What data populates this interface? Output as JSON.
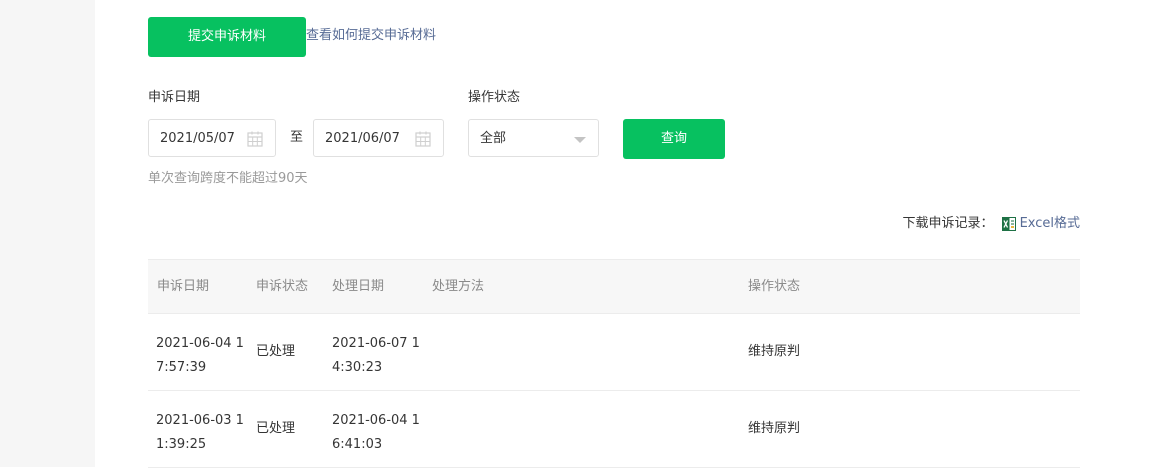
{
  "actions": {
    "submit_label": "提交申诉材料",
    "help_link": "查看如何提交申诉材料"
  },
  "filters": {
    "date_label": "申诉日期",
    "start_date": "2021/05/07",
    "range_separator": "至",
    "end_date": "2021/06/07",
    "status_label": "操作状态",
    "status_selected": "全部",
    "query_label": "查询",
    "hint": "单次查询跨度不能超过90天"
  },
  "download": {
    "label": "下载申诉记录：",
    "link": "Excel格式"
  },
  "table": {
    "headers": [
      "申诉日期",
      "申诉状态",
      "处理日期",
      "处理方法",
      "操作状态"
    ],
    "rows": [
      {
        "appeal_date": "2021-06-04 17:57:39",
        "appeal_status": "已处理",
        "process_date": "2021-06-07 14:30:23",
        "method": "",
        "op_status": "维持原判"
      },
      {
        "appeal_date": "2021-06-03 11:39:25",
        "appeal_status": "已处理",
        "process_date": "2021-06-04 16:41:03",
        "method": "",
        "op_status": "维持原判"
      }
    ]
  },
  "colors": {
    "brand_green": "#07c160",
    "link_blue": "#576b95",
    "hint_gray": "#9a9a9a"
  }
}
